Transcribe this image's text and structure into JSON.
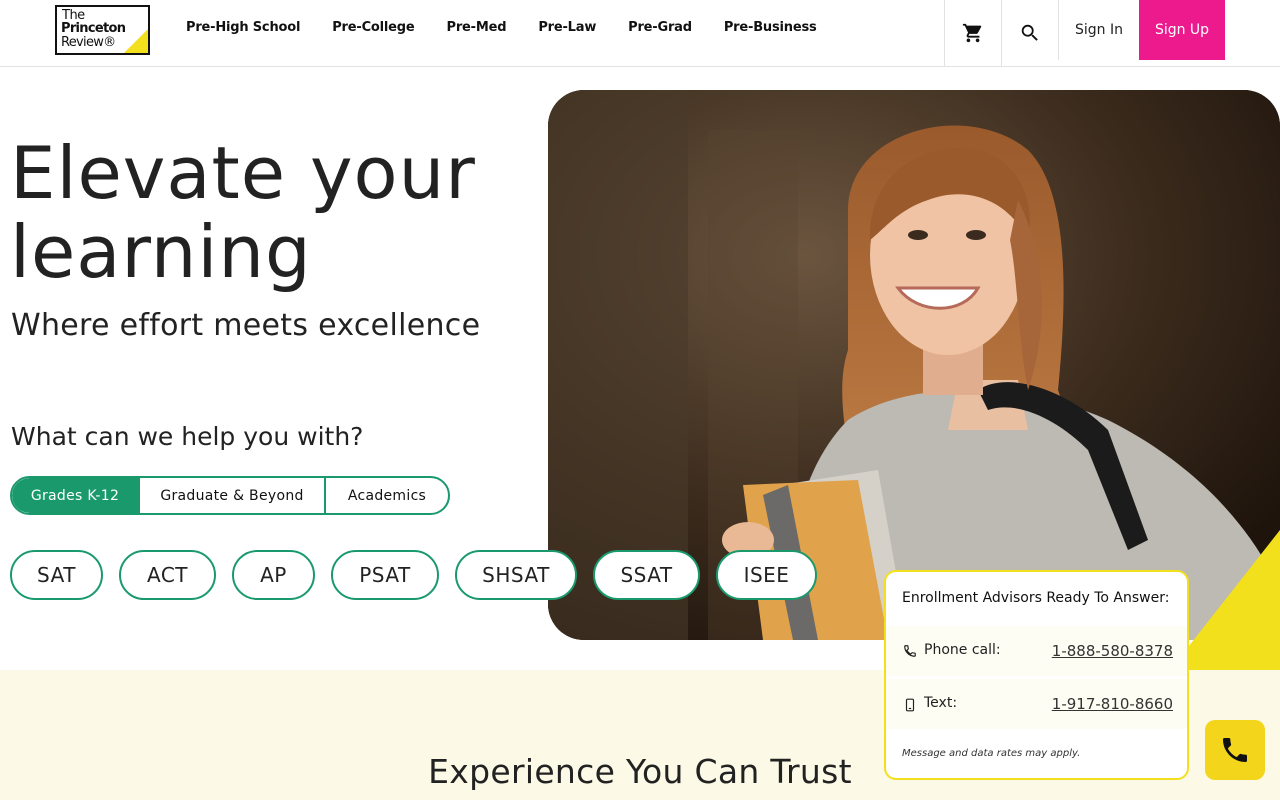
{
  "header": {
    "logo": {
      "line1": "The",
      "line2": "Princeton",
      "line3": "Review®"
    },
    "nav": [
      "Pre-High School",
      "Pre-College",
      "Pre-Med",
      "Pre-Law",
      "Pre-Grad",
      "Pre-Business"
    ],
    "sign_in": "Sign In",
    "sign_up": "Sign Up",
    "icons": [
      "cart-icon",
      "search-icon"
    ]
  },
  "hero": {
    "title": "Elevate your learning",
    "subtitle": "Where effort meets excellence",
    "help_question": "What can we help you with?",
    "tabs": [
      {
        "label": "Grades K-12",
        "active": true
      },
      {
        "label": "Graduate & Beyond",
        "active": false
      },
      {
        "label": "Academics",
        "active": false
      }
    ],
    "tests": [
      "SAT",
      "ACT",
      "AP",
      "PSAT",
      "SHSAT",
      "SSAT",
      "ISEE"
    ]
  },
  "advisor": {
    "heading": "Enrollment Advisors Ready To Answer:",
    "phone_label": "Phone call:",
    "phone_number": "1-888-580-8378",
    "text_label": "Text:",
    "text_number": "1-917-810-8660",
    "note": "Message and data rates may apply."
  },
  "trust": {
    "heading": "Experience You Can Trust"
  },
  "colors": {
    "brand_green": "#1a9a6c",
    "brand_pink": "#ec1a8d",
    "brand_yellow": "#f3e01c"
  }
}
